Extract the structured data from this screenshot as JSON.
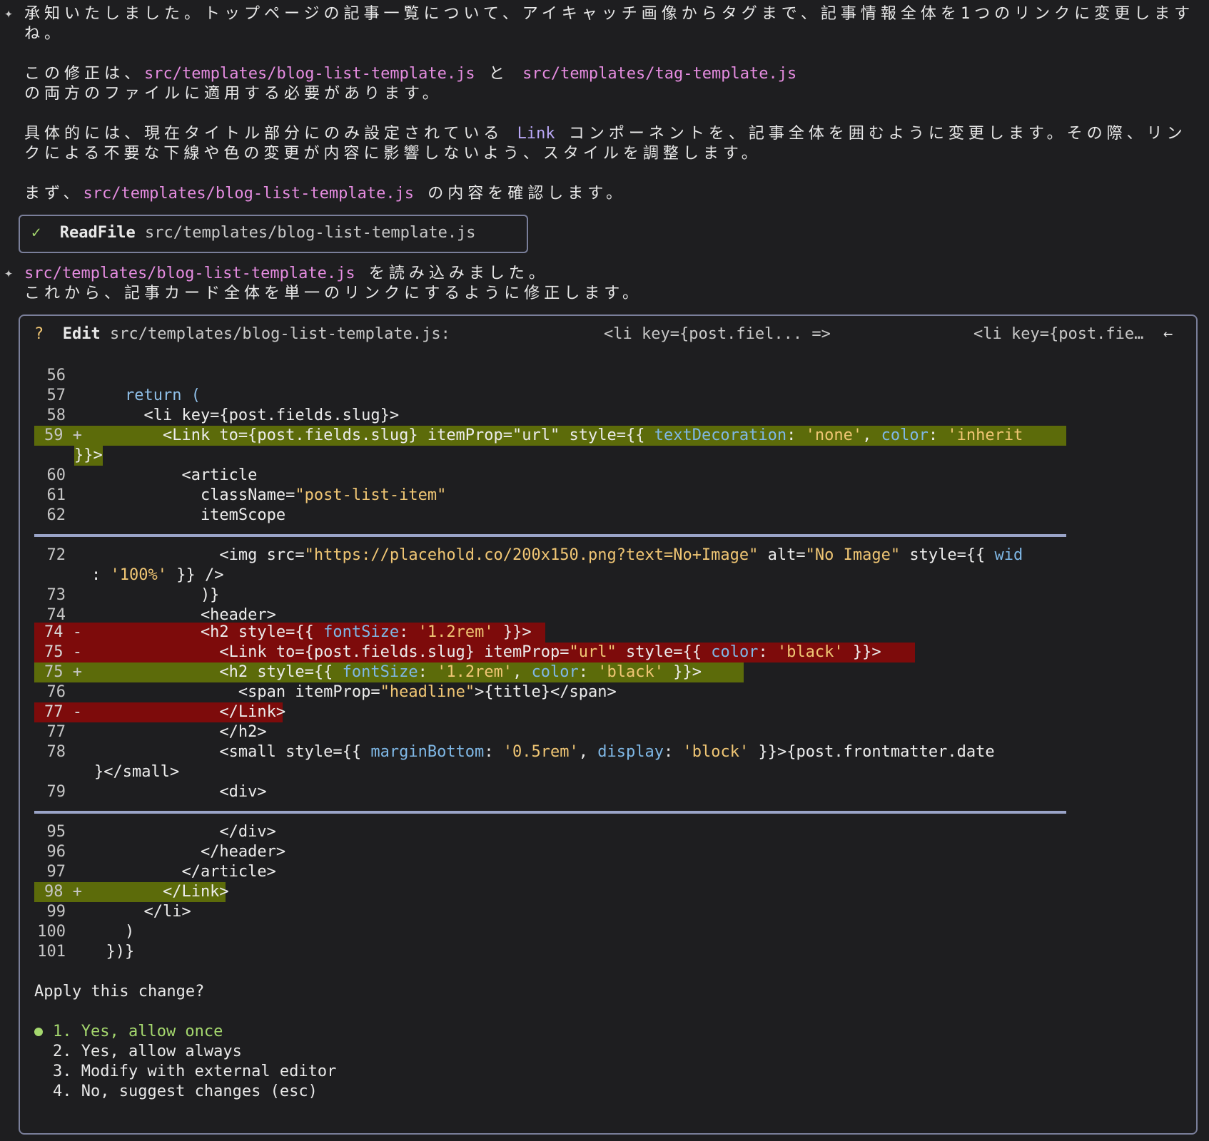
{
  "message": {
    "intro": [
      "承知いたしました。トップページの記事一覧について、アイキャッチ画像からタグまで、記事情報全体を1つのリンクに変更します",
      "ね。"
    ],
    "apply_pre": "この修正は、",
    "file_a": "src/templates/blog-list-template.js",
    "and": " と ",
    "file_b": "src/templates/tag-template.js",
    "apply_post": "の両方のファイルに適用する必要があります。",
    "detail_pre": "具体的には、現在タイトル部分にのみ設定されている ",
    "detail_kw": "Link",
    "detail_post": " コンポーネントを、記事全体を囲むように変更します。その際、リン",
    "detail_line2": "クによる不要な下線や色の変更が内容に影響しないよう、スタイルを調整します。",
    "check_pre": "まず、",
    "check_file": "src/templates/blog-list-template.js",
    "check_post": " の内容を確認します。"
  },
  "tool_call": {
    "check_icon": "✓",
    "name": "ReadFile",
    "arg": "src/templates/blog-list-template.js"
  },
  "message2": {
    "file": "src/templates/blog-list-template.js",
    "line1_post": " を読み込みました。",
    "line2": "これから、記事カード全体を単一のリンクにするように修正します。"
  },
  "edit": {
    "marker": "?",
    "label": "Edit",
    "file": "src/templates/blog-list-template.js:",
    "from": "<li key={post.fiel... =>",
    "to": "<li key={post.fie…",
    "arrow_icon": "←",
    "lines": {
      "l56": "56",
      "l57": "57",
      "c57": "    return (",
      "l58": "58",
      "c58": "      <li key={post.fields.slug}>",
      "l59": "59 +",
      "c59a": "        <Link to={post.fields.slug} itemProp=\"url\" style={{ ",
      "c59b": "textDecoration",
      "c59c": ": ",
      "c59d": "'none'",
      "c59e": ", ",
      "c59f": "color",
      "c59g": ": ",
      "c59h": "'inherit",
      "c59w": "}}>",
      "l60": "60",
      "c60": "          <article",
      "l61": "61",
      "c61a": "            className=",
      "c61b": "\"post-list-item\"",
      "l62": "62",
      "c62": "            itemScope",
      "l72": "72",
      "c72a": "              <img src=",
      "c72b": "\"https://placehold.co/200x150.png?text=No+Image\"",
      "c72c": " alt=",
      "c72d": "\"No Image\"",
      "c72e": " style={{ ",
      "c72f": "wid",
      "c72w1": ": ",
      "c72w2": "'100%'",
      "c72w3": " }} />",
      "l73": "73",
      "c73": "            )}",
      "l74": "74",
      "c74": "            <header>",
      "l74d": "74 -",
      "c74d1": "            <h2 style={{ ",
      "c74d2": "fontSize",
      "c74d3": ": ",
      "c74d4": "'1.2rem'",
      "c74d5": " }}>",
      "l75d": "75 -",
      "c75d1": "              <Link to={post.fields.slug} itemProp=",
      "c75d2": "\"url\"",
      "c75d3": " style={{ ",
      "c75d4": "color",
      "c75d5": ": ",
      "c75d6": "'black'",
      "c75d7": " }}>",
      "l75a": "75 +",
      "c75a1": "              <h2 style={{ ",
      "c75a2": "fontSize",
      "c75a3": ": ",
      "c75a4": "'1.2rem'",
      "c75a5": ", ",
      "c75a6": "color",
      "c75a7": ": ",
      "c75a8": "'black'",
      "c75a9": " }}>",
      "l76": "76",
      "c76a": "                <span itemProp=",
      "c76b": "\"headline\"",
      "c76c": ">{title}</span>",
      "l77d": "77 -",
      "c77d": "              </Link>",
      "l77": "77",
      "c77": "              </h2>",
      "l78": "78",
      "c78a": "              <small style={{ ",
      "c78b": "marginBottom",
      "c78c": ": ",
      "c78d": "'0.5rem'",
      "c78e": ", ",
      "c78f": "display",
      "c78g": ": ",
      "c78h": "'block'",
      "c78i": " }}>{post.frontmatter.date",
      "c78w": "}</small>",
      "l79": "79",
      "c79": "              <div>",
      "l95": "95",
      "c95": "              </div>",
      "l96": "96",
      "c96": "            </header>",
      "l97": "97",
      "c97": "          </article>",
      "l98": "98 +",
      "c98": "        </Link>",
      "l99": "99",
      "c99": "      </li>",
      "l100": "100",
      "c100": "    )",
      "l101": "101",
      "c101": "  })}"
    },
    "question": "Apply this change?",
    "options": [
      "1. Yes, allow once",
      "2. Yes, allow always",
      "3. Modify with external editor",
      "4. No, suggest changes (esc)"
    ]
  },
  "colors": {
    "background": "#1e1e20",
    "path": "#e58ce0",
    "added_line": "#5c6b0a",
    "removed_line": "#7d0b0b",
    "selected_option": "#a5d86e"
  }
}
